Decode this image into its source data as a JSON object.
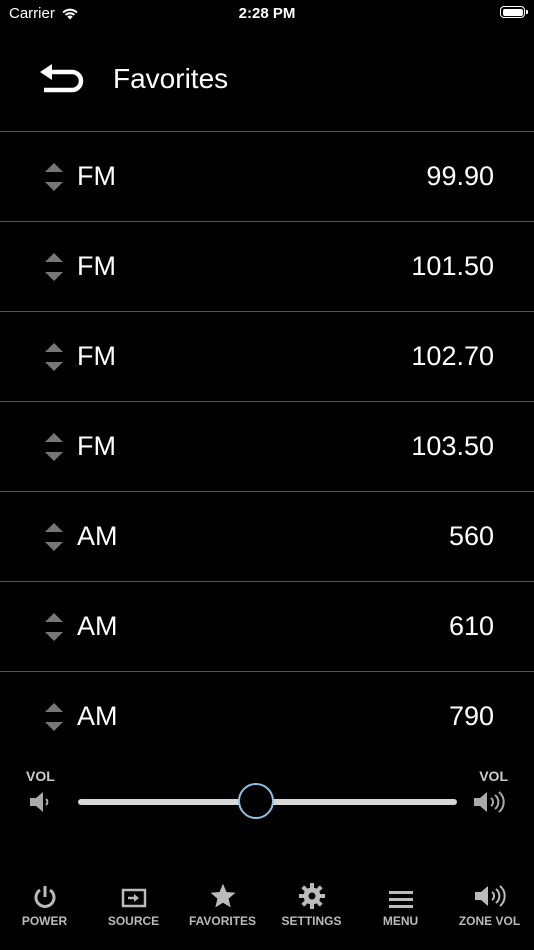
{
  "status_bar": {
    "carrier": "Carrier",
    "time": "2:28 PM"
  },
  "header": {
    "title": "Favorites"
  },
  "favorites": [
    {
      "band": "FM",
      "frequency": "99.90"
    },
    {
      "band": "FM",
      "frequency": "101.50"
    },
    {
      "band": "FM",
      "frequency": "102.70"
    },
    {
      "band": "FM",
      "frequency": "103.50"
    },
    {
      "band": "AM",
      "frequency": "560"
    },
    {
      "band": "AM",
      "frequency": "610"
    },
    {
      "band": "AM",
      "frequency": "790"
    }
  ],
  "volume": {
    "left_label": "VOL",
    "right_label": "VOL",
    "level": 0.47
  },
  "tabs": [
    {
      "label": "POWER",
      "icon": "power-icon"
    },
    {
      "label": "SOURCE",
      "icon": "source-icon"
    },
    {
      "label": "FAVORITES",
      "icon": "star-icon"
    },
    {
      "label": "SETTINGS",
      "icon": "gear-icon"
    },
    {
      "label": "MENU",
      "icon": "menu-icon"
    },
    {
      "label": "ZONE VOL",
      "icon": "zone-volume-icon"
    }
  ],
  "colors": {
    "background": "#000000",
    "divider": "#555555",
    "slider_thumb": "#8fc1e3",
    "slider_track": "#d8d8d8"
  }
}
